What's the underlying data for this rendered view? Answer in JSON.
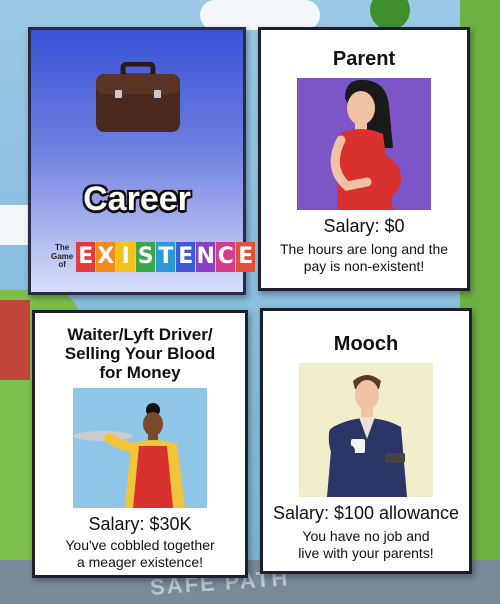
{
  "cards": {
    "career": {
      "title": "Career",
      "brand_small_1": "The",
      "brand_small_2": "Game",
      "brand_small_3": "of",
      "brand_letters": [
        "E",
        "X",
        "I",
        "S",
        "T",
        "E",
        "N",
        "C",
        "E"
      ],
      "brand_colors": [
        "#e23b3b",
        "#f08a1c",
        "#f2c21b",
        "#3aa84a",
        "#2b9ad6",
        "#3b5bd8",
        "#8a3fc4",
        "#d63a8a",
        "#e2503b"
      ]
    },
    "parent": {
      "title": "Parent",
      "salary": "Salary: $0",
      "desc_line1": "The hours are long and the",
      "desc_line2": "pay is non-existent!",
      "img_bg": "#7c55c7"
    },
    "waiter": {
      "title_line1": "Waiter/Lyft Driver/",
      "title_line2": "Selling Your Blood",
      "title_line3": "for Money",
      "salary": "Salary: $30K",
      "desc_line1": "You've cobbled together",
      "desc_line2": "a meager existence!",
      "img_bg": "#8fc6e8"
    },
    "mooch": {
      "title": "Mooch",
      "salary": "Salary: $100 allowance",
      "desc_line1": "You have no job and",
      "desc_line2": "live with your parents!",
      "img_bg": "#f2eecb"
    }
  },
  "board": {
    "road_text": "SAFE PATH"
  }
}
